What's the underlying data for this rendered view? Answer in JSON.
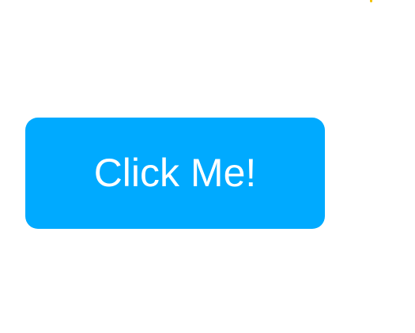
{
  "button": {
    "label": "Click Me!"
  },
  "colors": {
    "background": "#ffffff",
    "button_fill": "#00aaff",
    "button_text": "#ffffff",
    "corner_accent": "#f2c200"
  }
}
